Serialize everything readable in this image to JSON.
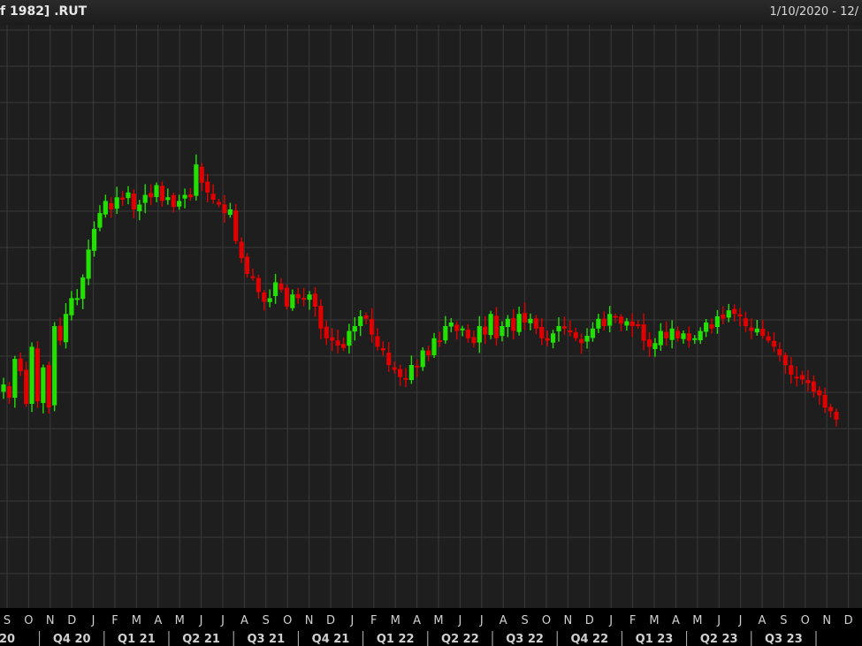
{
  "window": {
    "title_left": "f 1982] .RUT",
    "title_right": "1/10/2020 - 12/"
  },
  "colors": {
    "background": "#1e1e1e",
    "grid": "#3a3a3a",
    "up": "#22e000",
    "down": "#e00000",
    "text": "#d0d0d0"
  },
  "chart_data": {
    "type": "candlestick",
    "title": "",
    "grid": true,
    "x_months": [
      "S",
      "O",
      "N",
      "D",
      "J",
      "F",
      "M",
      "A",
      "M",
      "J",
      "J",
      "A",
      "S",
      "O",
      "N",
      "D",
      "J",
      "F",
      "M",
      "A",
      "M",
      "J",
      "J",
      "A",
      "S",
      "O",
      "N",
      "D",
      "J",
      "F",
      "M",
      "A",
      "M",
      "J",
      "J",
      "A",
      "S",
      "O",
      "N",
      "D"
    ],
    "x_quarters": [
      "20",
      "Q4 20",
      "Q1 21",
      "Q2 21",
      "Q3 21",
      "Q4 21",
      "Q1 22",
      "Q2 22",
      "Q3 22",
      "Q4 22",
      "Q1 23",
      "Q2 23",
      "Q3 23"
    ],
    "series": [
      {
        "values": [
          24,
          13,
          45,
          35,
          8,
          55,
          10,
          38,
          5,
          72,
          60,
          82,
          95,
          95,
          112,
          135,
          152,
          165,
          175,
          168,
          178,
          176,
          182,
          168,
          172,
          180,
          178,
          188,
          175,
          178,
          170,
          175,
          180,
          178,
          205,
          190,
          182,
          176,
          172,
          165,
          168,
          142,
          128,
          115,
          112,
          100,
          92,
          95,
          108,
          102,
          88,
          98,
          95,
          94,
          98,
          88,
          70,
          62,
          60,
          56,
          54,
          68,
          72,
          80,
          78,
          65,
          55,
          52,
          40,
          36,
          30,
          28,
          40,
          38,
          52,
          48,
          62,
          60,
          72,
          75,
          68,
          70,
          62,
          58,
          72,
          65,
          82,
          62,
          72,
          78,
          68,
          82,
          75,
          78,
          70,
          62,
          60,
          66,
          72,
          70,
          68,
          62,
          58,
          64,
          70,
          78,
          72,
          82,
          80,
          74,
          76,
          72,
          72,
          60,
          55,
          58,
          68,
          62,
          70,
          62,
          66,
          60,
          62,
          68,
          75,
          70,
          80,
          78,
          85,
          82,
          80,
          72,
          68,
          70,
          64,
          60,
          55,
          48,
          40,
          32,
          30,
          28,
          25,
          18,
          15,
          5,
          2,
          -5
        ]
      }
    ]
  }
}
